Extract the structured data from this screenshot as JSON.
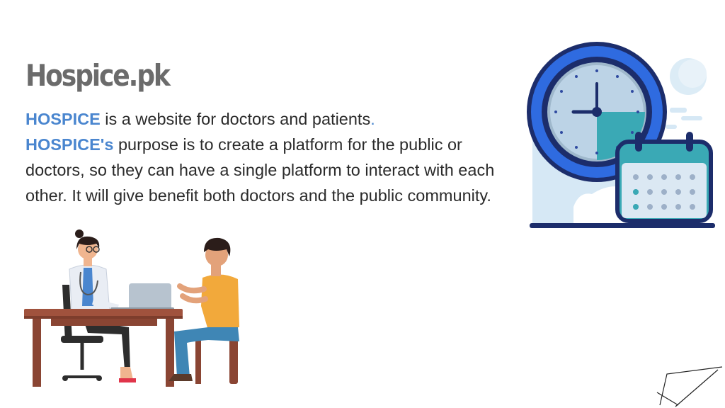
{
  "header": {
    "title": "Hospice.pk"
  },
  "intro": {
    "line1_highlight": "HOSPICE",
    "line1_text": " is a website for doctors and patients",
    "line1_dot": ".",
    "line2_highlight": "HOSPICE's",
    "line2_text": " purpose is to create a platform for the public or doctors, so they can have a single platform to interact with each other. It will give benefit both doctors and the public community."
  },
  "illustrations": {
    "consultation": "doctor-patient-consultation-illustration",
    "clock_calendar": "clock-calendar-illustration",
    "corner": "corner-line-decoration"
  },
  "colors": {
    "accent": "#4a86cf",
    "title": "#6b6b6b",
    "text": "#2b2b2b",
    "navy": "#1c2d6b",
    "clock_blue": "#2f6be0",
    "teal": "#3aa9b5"
  }
}
